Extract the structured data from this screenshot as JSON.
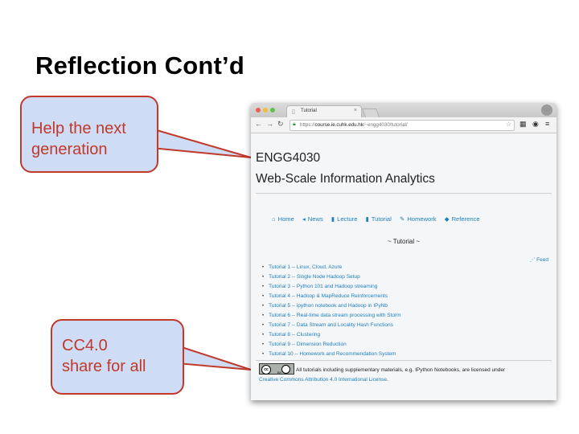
{
  "slide": {
    "title": "Reflection Cont’d"
  },
  "callouts": [
    {
      "line1": "Help the next",
      "line2": "generation"
    },
    {
      "line1": "CC4.0",
      "line2": "share for all"
    }
  ],
  "browser": {
    "tab_title": "Tutorial",
    "tab_close": "×",
    "url_scheme": "https://",
    "url_host": "course.ie.cuhk.edu.hk",
    "url_path": "/~engg4030/tutorial/",
    "icons": {
      "back": "arrow-left-icon",
      "forward": "arrow-right-icon",
      "reload": "reload-icon",
      "lock": "lock-icon",
      "star": "star-icon"
    }
  },
  "site": {
    "code": "ENGG4030",
    "name": "Web-Scale Information Analytics",
    "nav": [
      {
        "icon": "home-icon",
        "glyph": "⌂",
        "label": "Home"
      },
      {
        "icon": "bullhorn-icon",
        "glyph": "◂",
        "label": "News"
      },
      {
        "icon": "book-icon",
        "glyph": "▮",
        "label": "Lecture"
      },
      {
        "icon": "book-icon",
        "glyph": "▮",
        "label": "Tutorial"
      },
      {
        "icon": "pencil-icon",
        "glyph": "✎",
        "label": "Homework"
      },
      {
        "icon": "tag-icon",
        "glyph": "◆",
        "label": "Reference"
      }
    ],
    "section_heading": "~ Tutorial ~",
    "feed": "Feed",
    "tutorials": [
      "Tutorial 1 -- Linux, Cloud, Azure",
      "Tutorial 2 -- Single Node Hadoop Setup",
      "Tutorial 3 -- Python 101 and Hadoop streaming",
      "Tutorial 4 -- Hadoop & MapReduce Reinforcements",
      "Tutorial 5 -- ipython notebook and Hadoop in IPyNb",
      "Tutorial 6 -- Real-time data stream processing with Storm",
      "Tutorial 7 -- Data Stream and Locality Hash Functions",
      "Tutorial 8 -- Clustering",
      "Tutorial 9 -- Dimension Reduction",
      "Tutorial 10 -- Homework and Recommendation System"
    ],
    "license_text": "All tutorials including supplementary materials, e.g. IPython Notebooks, are licensed under",
    "license_link": "Creative Commons Attribution 4.0 International License",
    "license_end": ".",
    "cc_badge": "cc",
    "cc_by": "BY"
  },
  "colors": {
    "callout_border": "#c0392b",
    "callout_fill": "#cfdcf5",
    "link": "#1e7fc2"
  }
}
